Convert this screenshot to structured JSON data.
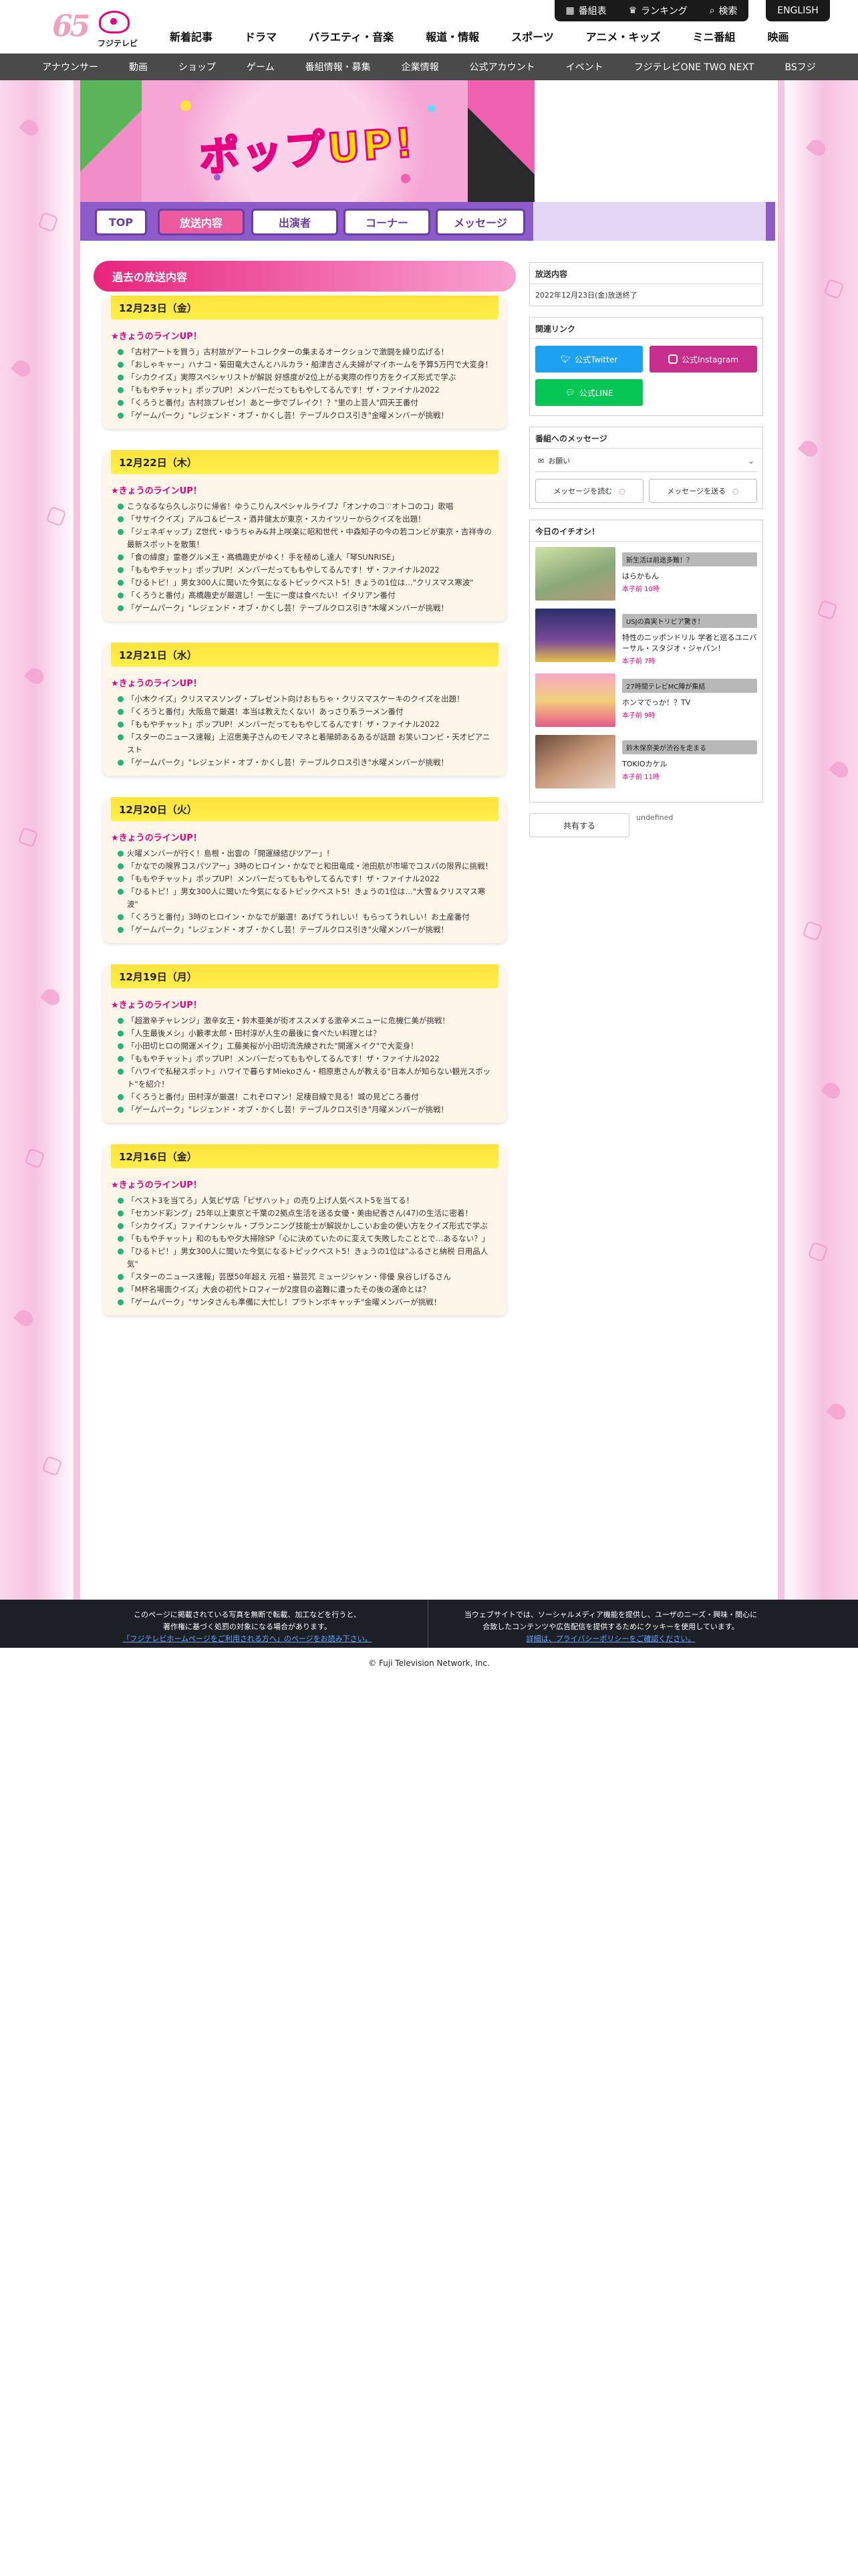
{
  "header": {
    "logo_text": "フジテレビ",
    "logo_num": "65",
    "util": [
      "番組表",
      "ランキング",
      "検索"
    ],
    "english": "ENGLISH",
    "gnav": [
      "新着記事",
      "ドラマ",
      "バラエティ・音楽",
      "報道・情報",
      "スポーツ",
      "アニメ・キッズ",
      "ミニ番組",
      "映画"
    ],
    "snav": [
      "アナウンサー",
      "動画",
      "ショップ",
      "ゲーム",
      "番組情報・募集",
      "企業情報",
      "公式アカウント",
      "イベント",
      "フジテレビONE TWO NEXT",
      "BSフジ"
    ]
  },
  "hero": {
    "title": "ポップUP!"
  },
  "tabs": [
    "TOP",
    "放送内容",
    "出演者",
    "コーナー",
    "メッセージ"
  ],
  "main": {
    "heading": "過去の放送内容",
    "lineup_label": "★きょうのラインUP！",
    "days": [
      {
        "date": "12月23日（金）",
        "items": [
          "「古村アートを買う」古村旅がアートコレクターの集まるオークションで激闘を繰り広げる！",
          "「おしゃキャー」ハナコ・菊田竜大さんとハルカラ・船津吉さん夫婦がマイホームを予算5万円で大変身！",
          "「シカクイズ」実際スペシャリストが解説 好感度が2位上がる実際の作り方をクイズ形式で学ぶ",
          "「ももやチャット」ポップUP！メンバーだってももやしてるんです！ザ・ファイナル2022",
          "「くろうと番付」古村旅プレゼン！あと一歩でブレイク！？\"里の上芸人\"四天王番付",
          "「ゲームパーク」\"レジェンド・オブ・かくし芸！テーブルクロス引き\"金曜メンバーが挑戦！"
        ]
      },
      {
        "date": "12月22日（木）",
        "items": [
          "こうなるなら久しぶりに帰省！ゆうこりんスペシャルライブ♪「オンナのコ♡オトコのコ」歌唱",
          "「ササイクイズ」アルコ＆ピース・酒井健太が東京・スカイツリーからクイズを出題！",
          "「ジェネギャップ」Z世代・ゆうちゃみ&井上咲楽に昭和世代・中森知子の今の若コンビが東京・吉祥寺の最新スポットを散策！",
          "「食の緯度」霊巻グルメ王・髙橋趣史がゆく！手を極めし達人「琴SUNRISE」",
          "「ももやチャット」ポップUP！メンバーだってももやしてるんです！ザ・ファイナル2022",
          "「ひるトピ！」男女300人に聞いた今気になるトピックベスト5！きょうの1位は…\"クリスマス寒波\"",
          "「くろうと番付」髙橋趣史が厳選し！一生に一度は食べたい！イタリアン番付",
          "「ゲームパーク」\"レジェンド・オブ・かくし芸！テーブルクロス引き\"木曜メンバーが挑戦！"
        ]
      },
      {
        "date": "12月21日（水）",
        "items": [
          "「小木クイズ」クリスマスソング・プレゼント向けおもちゃ・クリスマスケーキのクイズを出題！",
          "「くろうと番付」大阪島で厳選！本当は教えたくない！あっさり系ラーメン番付",
          "「ももやチャット」ポップUP！メンバーだってももやしてるんです！ザ・ファイナル2022",
          "「スターのニュース速報」上沼恵美子さんのモノマネと着陽師あるあるが話題 お笑いコンビ・天才ピアニスト",
          "「ゲームパーク」\"レジェンド・オブ・かくし芸！テーブルクロス引き\"水曜メンバーが挑戦！"
        ]
      },
      {
        "date": "12月20日（火）",
        "items": [
          "火曜メンバーが行く！島根・出雲の「開運縁結びツアー」！",
          "「かなでの険界コスパツアー」3時のヒロイン・かなでと和田竜成・池田航が市場でコスパの限界に挑戦！",
          "「ももやチャット」ポップUP！メンバーだってももやしてるんです！ザ・ファイナル2022",
          "「ひるトピ！」男女300人に聞いた今気になるトピックベスト5！きょうの1位は…\"大雪＆クリスマス寒波\"",
          "「くろうと番付」3時のヒロイン・かなでが厳選！あげてうれしい！もらってうれしい！お土産番付",
          "「ゲームパーク」\"レジェンド・オブ・かくし芸！テーブルクロス引き\"火曜メンバーが挑戦！"
        ]
      },
      {
        "date": "12月19日（月）",
        "items": [
          "「超激辛チャレンジ」激辛女王・鈴木亜美が街オススメする激辛メニューに危機仁美が挑戦！",
          "「人生最後メシ」小籔孝太郎・田村淳が人生の最後に食べたい料理とは？",
          "「小田切ヒロの開運メイク」工藤美桜が小田切流洗練された\"開運メイク\"で大変身！",
          "「ももやチャット」ポップUP！メンバーだってももやしてるんです！ザ・ファイナル2022",
          "「ハワイで私秘スポット」ハワイで暮らすMiekoさん・相原恵さんが教える\"日本人が知らない観光スポット\"を紹介！",
          "「くろうと番付」田村淳が厳選！これぞロマン！足棲目線で見る！城の見どころ番付",
          "「ゲームパーク」\"レジェンド・オブ・かくし芸！テーブルクロス引き\"月曜メンバーが挑戦！"
        ]
      },
      {
        "date": "12月16日（金）",
        "items": [
          "「ベスト3を当てろ」人気ピザ店「ピザハット」の売り上げ人気ベスト5を当てる！",
          "「セカンド彩ング」25年以上東京と千葉の2拠点生活を送る女優・美由紀香さん(47)の生活に密着！",
          "「シカクイズ」ファイナンシャル・プランニング技能士が解説かしこいお金の使い方をクイズ形式で学ぶ",
          "「ももやチャット」和のももや夕大掃除SP「心に決めていたのに変えて失敗したこととで…あるない？」",
          "「ひるトピ！」男女300人に聞いた今気になるトピックベスト5！きょうの1位は\"ふるさと納税 日用品人気\"",
          "「スターのニュース速報」芸歴50年超え 元祖・猫芸咒 ミュージシャン・俳優 泉谷しげるさん",
          "「M杯名場面クイズ」大会の初代トロフィーが2度目の盗難に遭ったその後の運命とは？",
          "「ゲームパーク」\"サンタさんも準備に大忙し！プラトンボキャッチ\"金曜メンバーが挑戦！"
        ]
      }
    ]
  },
  "side": {
    "broadcast_title": "放送内容",
    "broadcast_text": "2022年12月23日(金)放送終了",
    "links_title": "関連リンク",
    "links": [
      "公式Twitter",
      "公式Instagram",
      "公式LINE"
    ],
    "link_colors": [
      "#1da1f2",
      "#c72e8e",
      "#06c755"
    ],
    "msg_title": "番組へのメッセージ",
    "msg_select": "お願い",
    "msg_read": "メッセージを読む",
    "msg_send": "メッセージを送る",
    "pick_title": "今日のイチオシ！",
    "picks": [
      {
        "tag": "新生活は前途多難！？",
        "name": "はらかもん",
        "time": "本子前 10時"
      },
      {
        "tag": "USJの真実トリビア驚き！",
        "name": "特性のニッポンドリル 学者と巡るユニバーサル・スタジオ・ジャパン！",
        "time": "本子前 7時"
      },
      {
        "tag": "27時間テレビMC陣が集結",
        "name": "ホンマでっか！？TV",
        "time": "本子前 9時"
      },
      {
        "tag": "鈴木保奈美が渋谷を走まる",
        "name": "TOKIOカケル",
        "time": "本子前 11時"
      }
    ],
    "share": "共有する",
    "share_note": "undefined"
  },
  "footer": {
    "notice_left": [
      "このページに掲載されている写真を無断で転載、加工などを行うと、",
      "著作権に基づく処罰の対象になる場合があります。",
      "「フジテレビホームページをご利用される方へ」のページをお読み下さい。"
    ],
    "notice_right": [
      "当ウェブサイトでは、ソーシャルメディア機能を提供し、ユーザのニーズ・興味・関心に",
      "合致したコンテンツや広告配信を提供するためにクッキーを使用しています。",
      "詳細は、プライバシーポリシーをご確認ください。"
    ],
    "copyright": "© Fuji Television Network, Inc."
  }
}
